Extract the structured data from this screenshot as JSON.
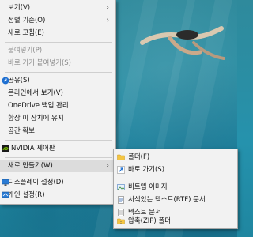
{
  "main_menu": {
    "view": "보기(V)",
    "sort_by": "정렬 기준(O)",
    "refresh": "새로 고침(E)",
    "paste": "붙여넣기(P)",
    "paste_shortcut": "바로 가기 붙여넣기(S)",
    "share": "공유(S)",
    "view_online": "온라인에서 보기(V)",
    "onedrive_backup": "OneDrive 백업 관리",
    "always_keep": "항상 이 장치에 유지",
    "free_up_space": "공간 확보",
    "nvidia_panel": "NVIDIA 제어판",
    "new": "새로 만들기(W)",
    "display_settings": "디스플레이 설정(D)",
    "personalize": "개인 설정(R)"
  },
  "new_submenu": {
    "folder": "폴더(F)",
    "shortcut": "바로 가기(S)",
    "bitmap": "비트맵 이미지",
    "rtf": "서식있는 텍스트(RTF) 문서",
    "text": "텍스트 문서",
    "zip": "압축(ZIP) 폴더"
  },
  "colors": {
    "menu_bg": "#f2f2f2",
    "hover_bg": "#dcdcdc",
    "disabled_text": "#8a8a8a",
    "desktop_water": "#2a8ea4"
  },
  "icons": {
    "submenu_arrow": "chevron-right-icon",
    "share": "share-icon",
    "cloud": "onedrive-cloud-icon",
    "nvidia": "nvidia-icon",
    "display": "display-icon",
    "personalize": "personalize-icon",
    "folder": "folder-icon",
    "shortcut": "shortcut-arrow-icon",
    "bitmap": "bitmap-icon",
    "rtf": "rtf-document-icon",
    "text": "text-document-icon",
    "zip": "zip-folder-icon"
  }
}
